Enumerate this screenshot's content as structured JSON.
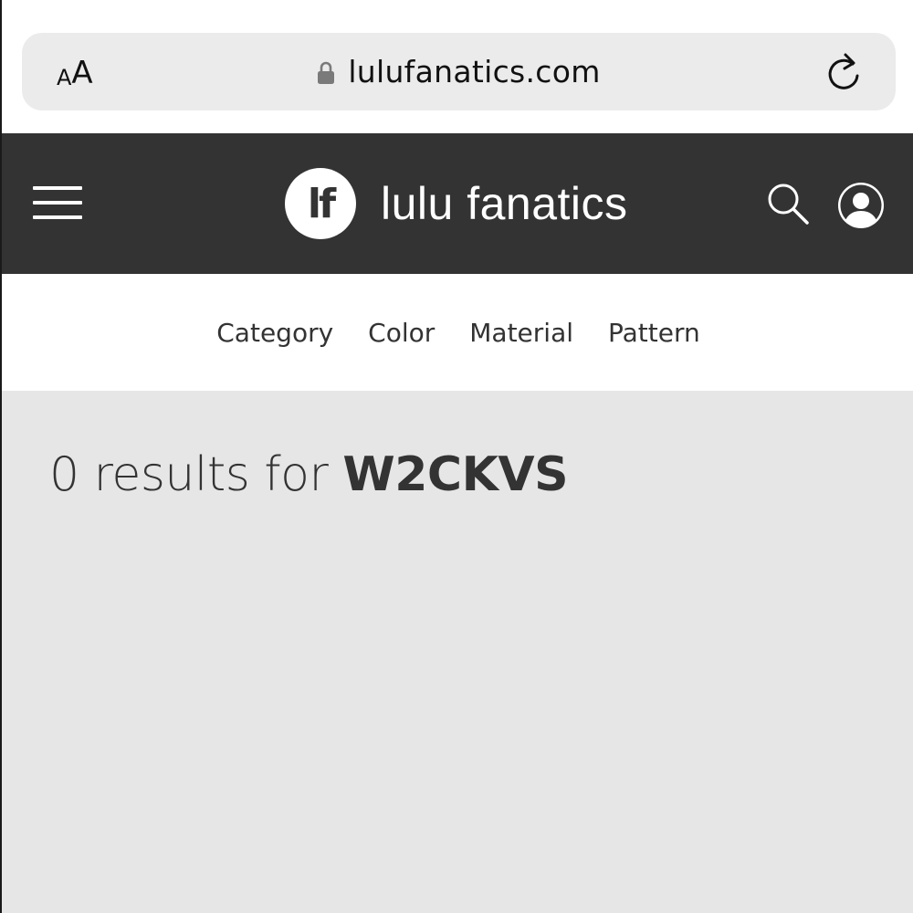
{
  "browser": {
    "text_size_small": "A",
    "text_size_large": "A",
    "url": "lulufanatics.com",
    "icons": [
      "lock-icon",
      "reload-icon"
    ]
  },
  "header": {
    "logo_mark": "lf",
    "site_name": "lulu fanatics",
    "background_color": "#333333",
    "icons": [
      "hamburger-menu-icon",
      "search-icon",
      "account-icon"
    ]
  },
  "filters": {
    "items": [
      "Category",
      "Color",
      "Material",
      "Pattern"
    ]
  },
  "results": {
    "prefix": "0 results for",
    "query": "W2CKVS",
    "background_color": "#e6e6e6"
  }
}
